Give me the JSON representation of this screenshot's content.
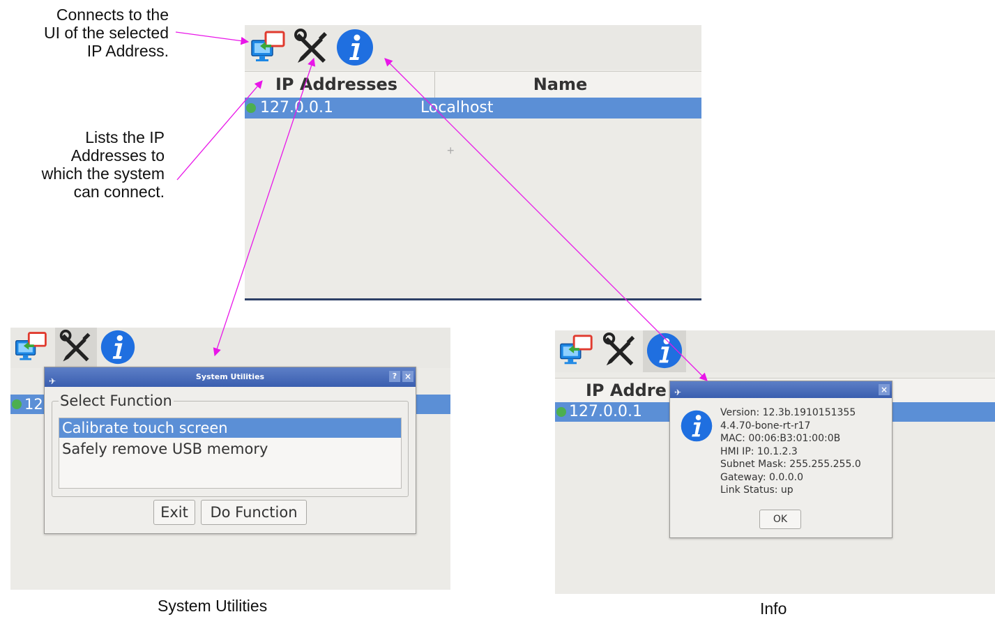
{
  "annotations": {
    "connects_line1": "Connects to the",
    "connects_line2": "UI of the selected",
    "connects_line3": "IP Address.",
    "lists_line1": "Lists the IP",
    "lists_line2": "Addresses to",
    "lists_line3": "which the system",
    "lists_line4": "can connect."
  },
  "captions": {
    "system_utilities": "System Utilities",
    "info": "Info"
  },
  "main_screen": {
    "col_ip": "IP Addresses",
    "col_name": "Name",
    "row_ip": "127.0.0.1",
    "row_name": "Localhost",
    "cursor": "+"
  },
  "utilities_screen": {
    "row_ip_partial": "12",
    "dialog_title": "System Utilities",
    "help_btn": "?",
    "close_btn": "×",
    "group_label": "Select Function",
    "options": [
      "Calibrate touch screen",
      "Safely remove USB memory"
    ],
    "exit_label": "Exit",
    "do_function_label": "Do Function"
  },
  "info_screen": {
    "col_ip_partial": "IP Addre",
    "row_ip": "127.0.0.1",
    "close_btn": "×",
    "lines": [
      "Version: 12.3b.1910151355",
      "4.4.70-bone-rt-r17",
      "MAC: 00:06:B3:01:00:0B",
      "HMI IP: 10.1.2.3",
      "Subnet Mask: 255.255.255.0",
      "Gateway: 0.0.0.0",
      "Link Status: up"
    ],
    "ok_label": "OK",
    "info_glyph": "i"
  },
  "icons": [
    "connect-monitor-icon",
    "tools-icon",
    "info-icon"
  ],
  "colors": {
    "arrow": "#e815e8",
    "selection": "#5b8fd6",
    "titlebar": "#4467b8",
    "info_blue": "#1f6fe0"
  }
}
